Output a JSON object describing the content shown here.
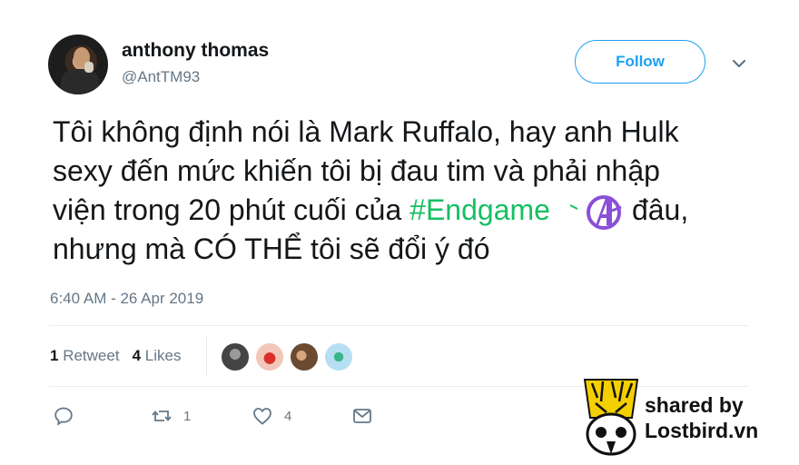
{
  "user": {
    "name": "anthony thomas",
    "handle": "@AntTM93"
  },
  "follow_label": "Follow",
  "tweet": {
    "line1": "Tôi không định nói là Mark Ruffalo, hay anh Hulk",
    "line2": "sexy đến mức khiến tôi bị đau tim và phải nhập",
    "line3_pre": "viện trong 20 phút cuối của ",
    "hashtag": "#Endgame",
    "line3_post": "đâu,",
    "line4": "nhưng mà CÓ THỂ tôi sẽ đổi ý đó",
    "hashtag_color": "#17bf63"
  },
  "timestamp": "6:40 AM - 26 Apr 2019",
  "stats": {
    "retweets_count": "1",
    "retweets_label": "Retweet",
    "likes_count": "4",
    "likes_label": "Likes"
  },
  "actions": {
    "reply_count": "",
    "retweet_count": "1",
    "like_count": "4"
  },
  "icons": [
    "caret-down-icon",
    "reply-icon",
    "retweet-icon",
    "like-icon",
    "message-icon",
    "avengers-emoji-icon"
  ],
  "watermark": {
    "line1": "shared by",
    "line2": "Lostbird.vn"
  },
  "colors": {
    "accent": "#1da1f2",
    "hashtag": "#17bf63",
    "secondary_text": "#657786",
    "avengers_purple": "#8a4fd8"
  }
}
